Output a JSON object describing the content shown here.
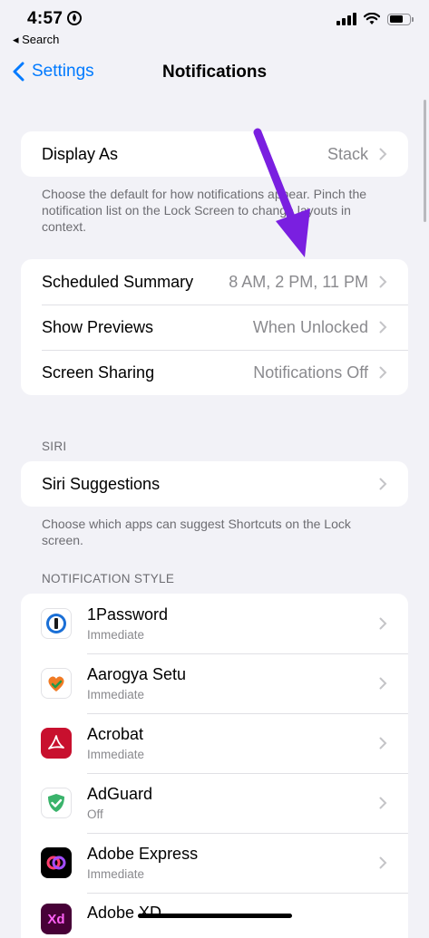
{
  "status_bar": {
    "time": "4:57",
    "back_to_app": "◂ Search"
  },
  "nav": {
    "back_label": "Settings",
    "title": "Notifications"
  },
  "display_group": {
    "rows": [
      {
        "label": "Display As",
        "value": "Stack"
      }
    ],
    "footer": "Choose the default for how notifications appear. Pinch the notification list on the Lock Screen to change layouts in context."
  },
  "summary_group": {
    "rows": [
      {
        "label": "Scheduled Summary",
        "value": "8 AM, 2 PM, 11 PM"
      },
      {
        "label": "Show Previews",
        "value": "When Unlocked"
      },
      {
        "label": "Screen Sharing",
        "value": "Notifications Off"
      }
    ]
  },
  "siri_section": {
    "header": "SIRI",
    "rows": [
      {
        "label": "Siri Suggestions"
      }
    ],
    "footer": "Choose which apps can suggest Shortcuts on the Lock screen."
  },
  "notification_style": {
    "header": "NOTIFICATION STYLE",
    "apps": [
      {
        "name": "1Password",
        "status": "Immediate",
        "icon": "1password-icon"
      },
      {
        "name": "Aarogya Setu",
        "status": "Immediate",
        "icon": "aarogya-setu-icon"
      },
      {
        "name": "Acrobat",
        "status": "Immediate",
        "icon": "acrobat-icon"
      },
      {
        "name": "AdGuard",
        "status": "Off",
        "icon": "adguard-icon"
      },
      {
        "name": "Adobe Express",
        "status": "Immediate",
        "icon": "adobe-express-icon"
      },
      {
        "name": "Adobe XD",
        "status": "",
        "icon": "adobe-xd-icon"
      }
    ]
  },
  "colors": {
    "accent": "#007aff",
    "annotation_arrow": "#7a1fe0",
    "background": "#f2f2f7"
  }
}
